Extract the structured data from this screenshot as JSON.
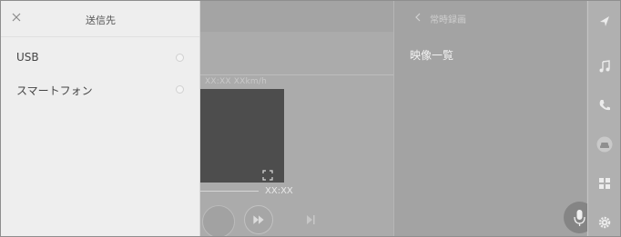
{
  "send_panel": {
    "title": "送信先",
    "destinations": [
      {
        "label": "USB"
      },
      {
        "label": "スマートフォン"
      }
    ]
  },
  "player": {
    "speed_text": "XX:XX   XXkm/h",
    "time_text": "XX:XX"
  },
  "video_list": {
    "title": "常時録画",
    "heading": "映像一覧"
  },
  "icons": {
    "close": "close-icon",
    "navigation": "navigation-arrow-icon",
    "music": "music-note-icon",
    "phone": "phone-icon",
    "car": "car-icon",
    "apps": "apps-grid-icon",
    "settings": "gear-icon",
    "mic": "microphone-icon",
    "expand": "expand-icon",
    "fast_forward": "fast-forward-icon",
    "next": "skip-next-icon",
    "back": "chevron-left-icon"
  },
  "colors": {
    "panel_bg": "#eeeeee",
    "dim_overlay": "#a9a9a9",
    "video_thumb": "#4d4d4d"
  }
}
